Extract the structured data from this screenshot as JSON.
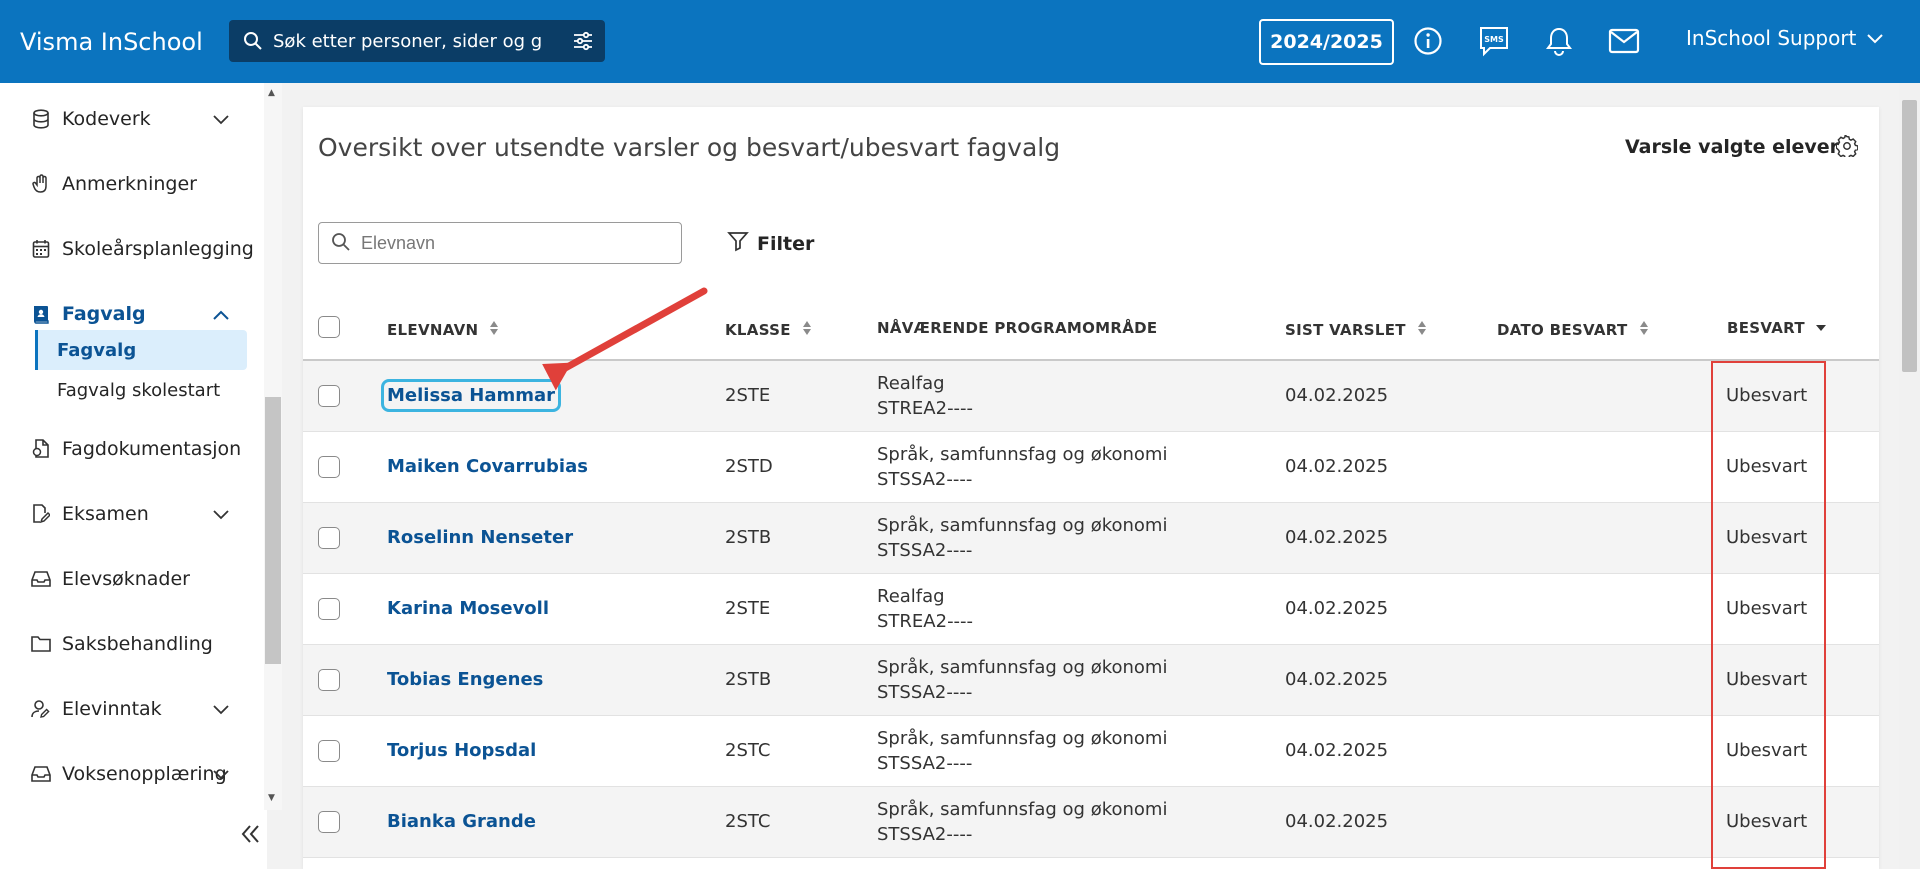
{
  "app": {
    "title": "Visma InSchool"
  },
  "topbar": {
    "search_placeholder": "Søk etter personer, sider og gru",
    "school_year": "2024/2025",
    "user_name": "InSchool Support"
  },
  "sidebar": {
    "items": [
      {
        "label": "Kodeverk",
        "icon": "database-icon",
        "expandable": true
      },
      {
        "label": "Anmerkninger",
        "icon": "hand-icon",
        "expandable": false
      },
      {
        "label": "Skoleårsplanlegging",
        "icon": "calendar-icon",
        "expandable": false
      },
      {
        "label": "Fagvalg",
        "icon": "book-icon",
        "expandable": true,
        "expanded": true
      },
      {
        "label": "Fagdokumentasjon",
        "icon": "document-icon",
        "expandable": false
      },
      {
        "label": "Eksamen",
        "icon": "edit-document-icon",
        "expandable": true
      },
      {
        "label": "Elevsøknader",
        "icon": "inbox-icon",
        "expandable": false
      },
      {
        "label": "Saksbehandling",
        "icon": "folder-icon",
        "expandable": false
      },
      {
        "label": "Elevinntak",
        "icon": "user-edit-icon",
        "expandable": true
      },
      {
        "label": "Voksenopplæring",
        "icon": "inbox-icon",
        "expandable": true
      }
    ],
    "sub_items": [
      {
        "label": "Fagvalg",
        "active": true
      },
      {
        "label": "Fagvalg skolestart",
        "active": false
      }
    ]
  },
  "main": {
    "title": "Oversikt over utsendte varsler og besvart/ubesvart fagvalg",
    "notify_button": "Varsle valgte elever",
    "search_placeholder": "Elevnavn",
    "filter_label": "Filter",
    "columns": {
      "name": "ELEVNAVN",
      "class": "KLASSE",
      "program": "NÅVÆRENDE PROGRAMOMRÅDE",
      "last_notified": "SIST VARSLET",
      "answered_date": "DATO BESVART",
      "answered": "BESVART"
    },
    "rows": [
      {
        "name": "Melissa Hammar",
        "class": "2STE",
        "program": "Realfag",
        "program_code": "STREA2----",
        "last_notified": "04.02.2025",
        "answered_date": "",
        "answered": "Ubesvart"
      },
      {
        "name": "Maiken Covarrubias",
        "class": "2STD",
        "program": "Språk, samfunnsfag og økonomi",
        "program_code": "STSSA2----",
        "last_notified": "04.02.2025",
        "answered_date": "",
        "answered": "Ubesvart"
      },
      {
        "name": "Roselinn Nenseter",
        "class": "2STB",
        "program": "Språk, samfunnsfag og økonomi",
        "program_code": "STSSA2----",
        "last_notified": "04.02.2025",
        "answered_date": "",
        "answered": "Ubesvart"
      },
      {
        "name": "Karina Mosevoll",
        "class": "2STE",
        "program": "Realfag",
        "program_code": "STREA2----",
        "last_notified": "04.02.2025",
        "answered_date": "",
        "answered": "Ubesvart"
      },
      {
        "name": "Tobias Engenes",
        "class": "2STB",
        "program": "Språk, samfunnsfag og økonomi",
        "program_code": "STSSA2----",
        "last_notified": "04.02.2025",
        "answered_date": "",
        "answered": "Ubesvart"
      },
      {
        "name": "Torjus Hopsdal",
        "class": "2STC",
        "program": "Språk, samfunnsfag og økonomi",
        "program_code": "STSSA2----",
        "last_notified": "04.02.2025",
        "answered_date": "",
        "answered": "Ubesvart"
      },
      {
        "name": "Bianka Grande",
        "class": "2STC",
        "program": "Språk, samfunnsfag og økonomi",
        "program_code": "STSSA2----",
        "last_notified": "04.02.2025",
        "answered_date": "",
        "answered": "Ubesvart"
      }
    ]
  },
  "colors": {
    "topbar": "#0b74bf",
    "search_bg": "#0b3d66",
    "link": "#0b5394",
    "highlight": "#e0403a",
    "focus": "#3cb4e0"
  }
}
